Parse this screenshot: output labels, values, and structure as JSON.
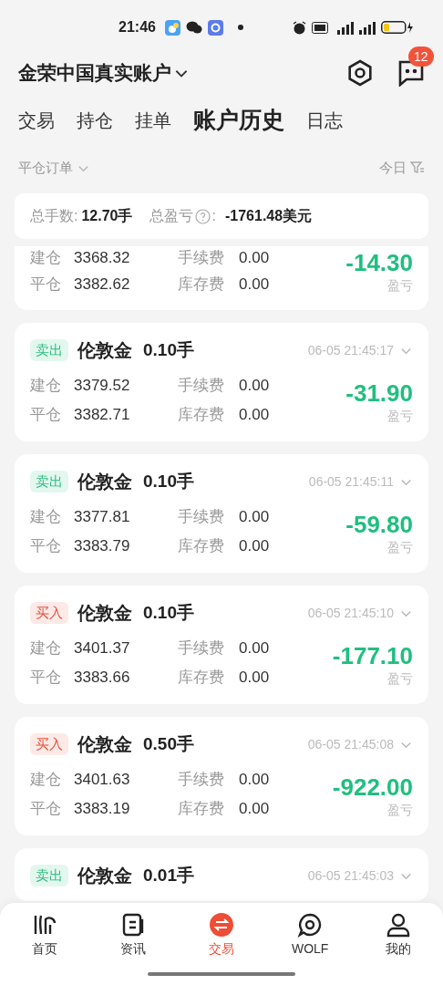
{
  "status_bar": {
    "time": "21:46"
  },
  "header": {
    "account": "金荣中国真实账户",
    "badge": "12"
  },
  "tabs": [
    {
      "label": "交易",
      "selected": false
    },
    {
      "label": "持仓",
      "selected": false
    },
    {
      "label": "挂单",
      "selected": false
    },
    {
      "label": "账户历史",
      "selected": true
    },
    {
      "label": "日志",
      "selected": false
    }
  ],
  "filter": {
    "type": "平仓订单",
    "date": "今日"
  },
  "summary": {
    "lots_label": "总手数:",
    "lots": "12.70手",
    "pnl_label": "总盈亏",
    "pnl_colon": ":",
    "pnl": "-1761.48美元"
  },
  "partial_order": {
    "open_label": "建仓",
    "open": "3368.32",
    "fee_label": "手续费",
    "fee": "0.00",
    "close_label": "平仓",
    "close": "3382.62",
    "swap_label": "库存费",
    "swap": "0.00",
    "pnl": "-14.30",
    "pnl_label": "盈亏"
  },
  "orders": [
    {
      "kind": "sell",
      "side": "卖出",
      "symbol": "伦敦金",
      "lots": "0.10手",
      "time": "06-05 21:45:17",
      "open_label": "建仓",
      "open": "3379.52",
      "fee_label": "手续费",
      "fee": "0.00",
      "close_label": "平仓",
      "close": "3382.71",
      "swap_label": "库存费",
      "swap": "0.00",
      "pnl": "-31.90",
      "pnl_label": "盈亏"
    },
    {
      "kind": "sell",
      "side": "卖出",
      "symbol": "伦敦金",
      "lots": "0.10手",
      "time": "06-05 21:45:11",
      "open_label": "建仓",
      "open": "3377.81",
      "fee_label": "手续费",
      "fee": "0.00",
      "close_label": "平仓",
      "close": "3383.79",
      "swap_label": "库存费",
      "swap": "0.00",
      "pnl": "-59.80",
      "pnl_label": "盈亏"
    },
    {
      "kind": "buy",
      "side": "买入",
      "symbol": "伦敦金",
      "lots": "0.10手",
      "time": "06-05 21:45:10",
      "open_label": "建仓",
      "open": "3401.37",
      "fee_label": "手续费",
      "fee": "0.00",
      "close_label": "平仓",
      "close": "3383.66",
      "swap_label": "库存费",
      "swap": "0.00",
      "pnl": "-177.10",
      "pnl_label": "盈亏"
    },
    {
      "kind": "buy",
      "side": "买入",
      "symbol": "伦敦金",
      "lots": "0.50手",
      "time": "06-05 21:45:08",
      "open_label": "建仓",
      "open": "3401.63",
      "fee_label": "手续费",
      "fee": "0.00",
      "close_label": "平仓",
      "close": "3383.19",
      "swap_label": "库存费",
      "swap": "0.00",
      "pnl": "-922.00",
      "pnl_label": "盈亏"
    },
    {
      "kind": "sell",
      "side": "卖出",
      "symbol": "伦敦金",
      "lots": "0.01手",
      "time": "06-05 21:45:03"
    }
  ],
  "nav": [
    {
      "kind": "home",
      "label": "首页",
      "selected": false
    },
    {
      "kind": "news",
      "label": "资讯",
      "selected": false
    },
    {
      "kind": "trade",
      "label": "交易",
      "selected": true
    },
    {
      "kind": "wolf",
      "label": "WOLF",
      "selected": false
    },
    {
      "kind": "me",
      "label": "我的",
      "selected": false
    }
  ]
}
